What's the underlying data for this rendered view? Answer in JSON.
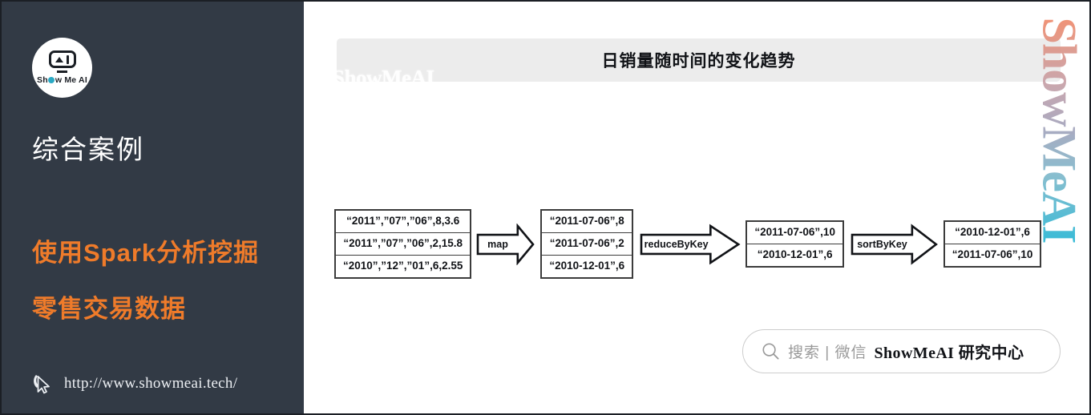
{
  "colors": {
    "sidebar_bg": "#323a45",
    "accent_orange": "#ef7b2a",
    "title_bar_bg": "#ececec",
    "text_white": "#ffffff",
    "logo_accent": "#2aa9c4"
  },
  "sidebar": {
    "logo": {
      "text": "Show Me AI",
      "text_before_o": "Sh",
      "text_after_o": "w Me AI",
      "icon_name": "robot-head-icon"
    },
    "title": "综合案例",
    "headline_line1": "使用Spark分析挖掘",
    "headline_line2": "零售交易数据",
    "footer_url": "http://www.showmeai.tech/",
    "footer_icon_name": "cursor-pointer-icon"
  },
  "main": {
    "title": "日销量随时间的变化趋势",
    "watermark_title": "ShowMeAI",
    "watermark_vertical": "ShowMeAI"
  },
  "flow": {
    "stages": [
      {
        "type": "box",
        "name": "input-data-box",
        "rows": [
          "“2011”,”07”,”06”,8,3.6",
          "“2011”,”07”,”06”,2,15.8",
          "“2010”,”12”,”01”,6,2.55"
        ]
      },
      {
        "type": "arrow",
        "name": "map-arrow",
        "label": "map"
      },
      {
        "type": "box",
        "name": "mapped-data-box",
        "rows": [
          "“2011-07-06”,8",
          "“2011-07-06”,2",
          "“2010-12-01”,6"
        ]
      },
      {
        "type": "arrow",
        "name": "reduce-by-key-arrow",
        "label": "reduceByKey"
      },
      {
        "type": "box",
        "name": "reduced-data-box",
        "rows": [
          "“2011-07-06”,10",
          "“2010-12-01”,6"
        ]
      },
      {
        "type": "arrow",
        "name": "sort-by-key-arrow",
        "label": "sortByKey"
      },
      {
        "type": "box",
        "name": "sorted-data-box",
        "rows": [
          "“2010-12-01”,6",
          "“2011-07-06”,10"
        ]
      }
    ]
  },
  "search": {
    "icon_name": "magnifier-icon",
    "placeholder": "搜索 | 微信",
    "brand": "ShowMeAI 研究中心"
  }
}
